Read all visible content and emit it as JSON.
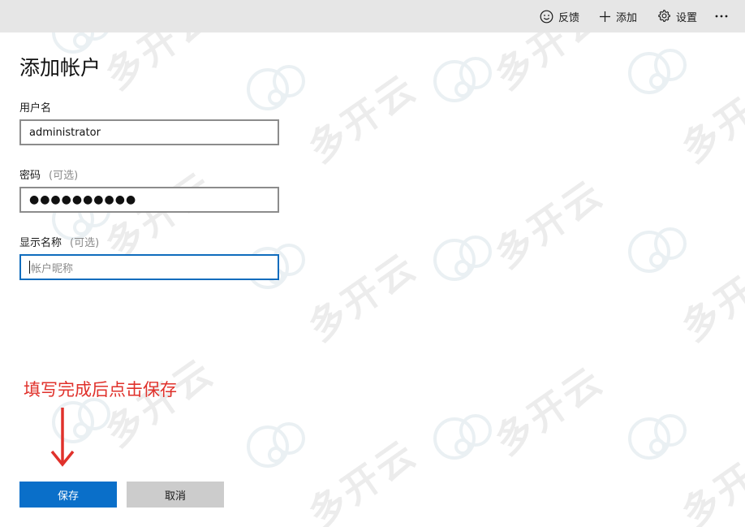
{
  "toolbar": {
    "feedback_label": "反馈",
    "add_label": "添加",
    "settings_label": "设置",
    "feedback_icon": "smiley-icon",
    "add_icon": "plus-icon",
    "settings_icon": "gear-icon",
    "more_icon": "ellipsis-icon"
  },
  "form": {
    "title": "添加帐户",
    "username": {
      "label": "用户名",
      "value": "administrator"
    },
    "password": {
      "label": "密码",
      "optional": "(可选)",
      "value": "●●●●●●●●●●"
    },
    "display_name": {
      "label": "显示名称",
      "optional": "(可选)",
      "placeholder": "帐户昵称",
      "value": ""
    }
  },
  "annotation": {
    "text": "填写完成后点击保存",
    "color": "#e0312b"
  },
  "buttons": {
    "save": "保存",
    "cancel": "取消"
  },
  "colors": {
    "accent": "#0a6fc9",
    "toolbar_bg": "#e6e6e6",
    "secondary_button": "#cccccc"
  },
  "watermark": {
    "text": "多开云"
  }
}
